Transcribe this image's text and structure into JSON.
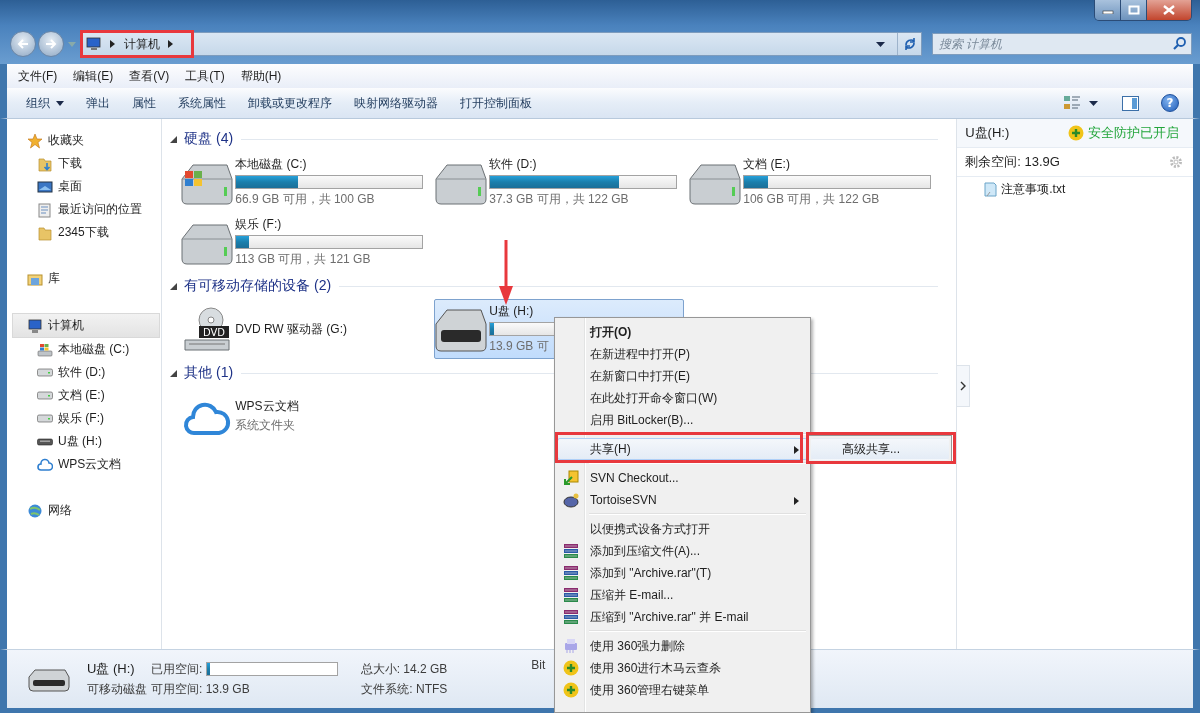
{
  "address": {
    "path": [
      "计算机"
    ]
  },
  "search": {
    "placeholder": "搜索 计算机"
  },
  "menu_bar": [
    "文件(F)",
    "编辑(E)",
    "查看(V)",
    "工具(T)",
    "帮助(H)"
  ],
  "toolbar": {
    "buttons": [
      {
        "label": "组织",
        "dropdown": true
      },
      {
        "label": "弹出",
        "dropdown": false
      },
      {
        "label": "属性",
        "dropdown": false
      },
      {
        "label": "系统属性",
        "dropdown": false
      },
      {
        "label": "卸载或更改程序",
        "dropdown": false
      },
      {
        "label": "映射网络驱动器",
        "dropdown": false
      },
      {
        "label": "打开控制面板",
        "dropdown": false
      }
    ],
    "help": "?"
  },
  "nav": [
    {
      "label": "收藏夹",
      "kind": "star",
      "selected": false,
      "children": [
        {
          "label": "下载",
          "kind": "download",
          "selected": false
        },
        {
          "label": "桌面",
          "kind": "desktop",
          "selected": false
        },
        {
          "label": "最近访问的位置",
          "kind": "recent",
          "selected": false
        },
        {
          "label": "2345下载",
          "kind": "folder",
          "selected": false
        }
      ]
    },
    {
      "label": "库",
      "kind": "library",
      "selected": false
    },
    {
      "label": "计算机",
      "kind": "computer",
      "selected": true,
      "children": [
        {
          "label": "本地磁盘 (C:)",
          "kind": "system",
          "selected": false
        },
        {
          "label": "软件 (D:)",
          "kind": "drive",
          "selected": false
        },
        {
          "label": "文档 (E:)",
          "kind": "drive",
          "selected": false
        },
        {
          "label": "娱乐 (F:)",
          "kind": "drive",
          "selected": false
        },
        {
          "label": "U盘 (H:)",
          "kind": "usb",
          "selected": false
        },
        {
          "label": "WPS云文档",
          "kind": "cloud",
          "selected": false
        }
      ]
    },
    {
      "label": "网络",
      "kind": "network",
      "selected": false
    }
  ],
  "sections": [
    {
      "title": "硬盘 (4)",
      "expanded": true,
      "items": [
        {
          "name": "本地磁盘 (C:)",
          "kind": "system",
          "level": 0.33,
          "caption": "66.9 GB 可用，共 100 GB",
          "selected": false
        },
        {
          "name": "软件 (D:)",
          "kind": "drive",
          "level": 0.69,
          "caption": "37.3 GB 可用，共 122 GB",
          "selected": false
        },
        {
          "name": "文档 (E:)",
          "kind": "drive",
          "level": 0.13,
          "caption": "106 GB 可用，共 122 GB",
          "selected": false
        },
        {
          "name": "娱乐 (F:)",
          "kind": "drive",
          "level": 0.07,
          "caption": "113 GB 可用，共 121 GB",
          "selected": false
        }
      ]
    },
    {
      "title": "有可移动存储的设备 (2)",
      "expanded": true,
      "items": [
        {
          "name": "DVD RW 驱动器 (G:)",
          "kind": "dvd",
          "icon_label": "DVD",
          "selected": false
        },
        {
          "name": "U盘 (H:)",
          "kind": "usb",
          "level": 0.02,
          "caption": "13.9 GB 可",
          "selected": true
        }
      ]
    },
    {
      "title": "其他 (1)",
      "expanded": true,
      "items": [
        {
          "name": "WPS云文档",
          "kind": "cloud",
          "caption": "系统文件夹",
          "selected": false
        }
      ]
    }
  ],
  "preview": {
    "title": "U盘(H:)",
    "protection": "安全防护已开启",
    "free_space": "剩余空间: 13.9G",
    "files": [
      {
        "name": "注意事项.txt"
      }
    ]
  },
  "status_bar": {
    "name": "U盘 (H:)",
    "type": "可移动磁盘",
    "used": {
      "label": "已用空间:",
      "level": 0.02
    },
    "free": "可用空间: 13.9 GB",
    "total": "总大小: 14.2 GB",
    "file_system": "文件系统: NTFS",
    "extra": "Bit"
  },
  "context_menu": {
    "groups": [
      [
        {
          "label": "打开(O)",
          "kind": "plain",
          "default": true,
          "submenu": false,
          "selected": false
        },
        {
          "label": "在新进程中打开(P)",
          "kind": "plain",
          "default": false,
          "submenu": false,
          "selected": false
        },
        {
          "label": "在新窗口中打开(E)",
          "kind": "plain",
          "default": false,
          "submenu": false,
          "selected": false
        },
        {
          "label": "在此处打开命令窗口(W)",
          "kind": "plain",
          "default": false,
          "submenu": false,
          "selected": false
        },
        {
          "label": "启用 BitLocker(B)...",
          "kind": "plain",
          "default": false,
          "submenu": false,
          "selected": false
        }
      ],
      [
        {
          "label": "共享(H)",
          "kind": "plain",
          "default": false,
          "submenu": true,
          "selected": true
        }
      ],
      [
        {
          "label": "SVN Checkout...",
          "kind": "svn",
          "default": false,
          "submenu": false,
          "selected": false
        },
        {
          "label": "TortoiseSVN",
          "kind": "tortoise",
          "default": false,
          "submenu": true,
          "selected": false
        }
      ],
      [
        {
          "label": "以便携式设备方式打开",
          "kind": "plain",
          "default": false,
          "submenu": false,
          "selected": false
        },
        {
          "label": "添加到压缩文件(A)...",
          "kind": "archive",
          "default": false,
          "submenu": false,
          "selected": false
        },
        {
          "label": "添加到 \"Archive.rar\"(T)",
          "kind": "archive",
          "default": false,
          "submenu": false,
          "selected": false
        },
        {
          "label": "压缩并 E-mail...",
          "kind": "archive",
          "default": false,
          "submenu": false,
          "selected": false
        },
        {
          "label": "压缩到 \"Archive.rar\" 并 E-mail",
          "kind": "archive",
          "default": false,
          "submenu": false,
          "selected": false
        }
      ],
      [
        {
          "label": "使用 360强力删除",
          "kind": "shredder",
          "default": false,
          "submenu": false,
          "selected": false
        },
        {
          "label": "使用 360进行木马云查杀",
          "kind": "shield",
          "default": false,
          "submenu": false,
          "selected": false
        },
        {
          "label": "使用 360管理右键菜单",
          "kind": "shield",
          "default": false,
          "submenu": false,
          "selected": false
        }
      ]
    ],
    "submenu": [
      {
        "label": "高级共享...",
        "selected": true
      }
    ]
  }
}
